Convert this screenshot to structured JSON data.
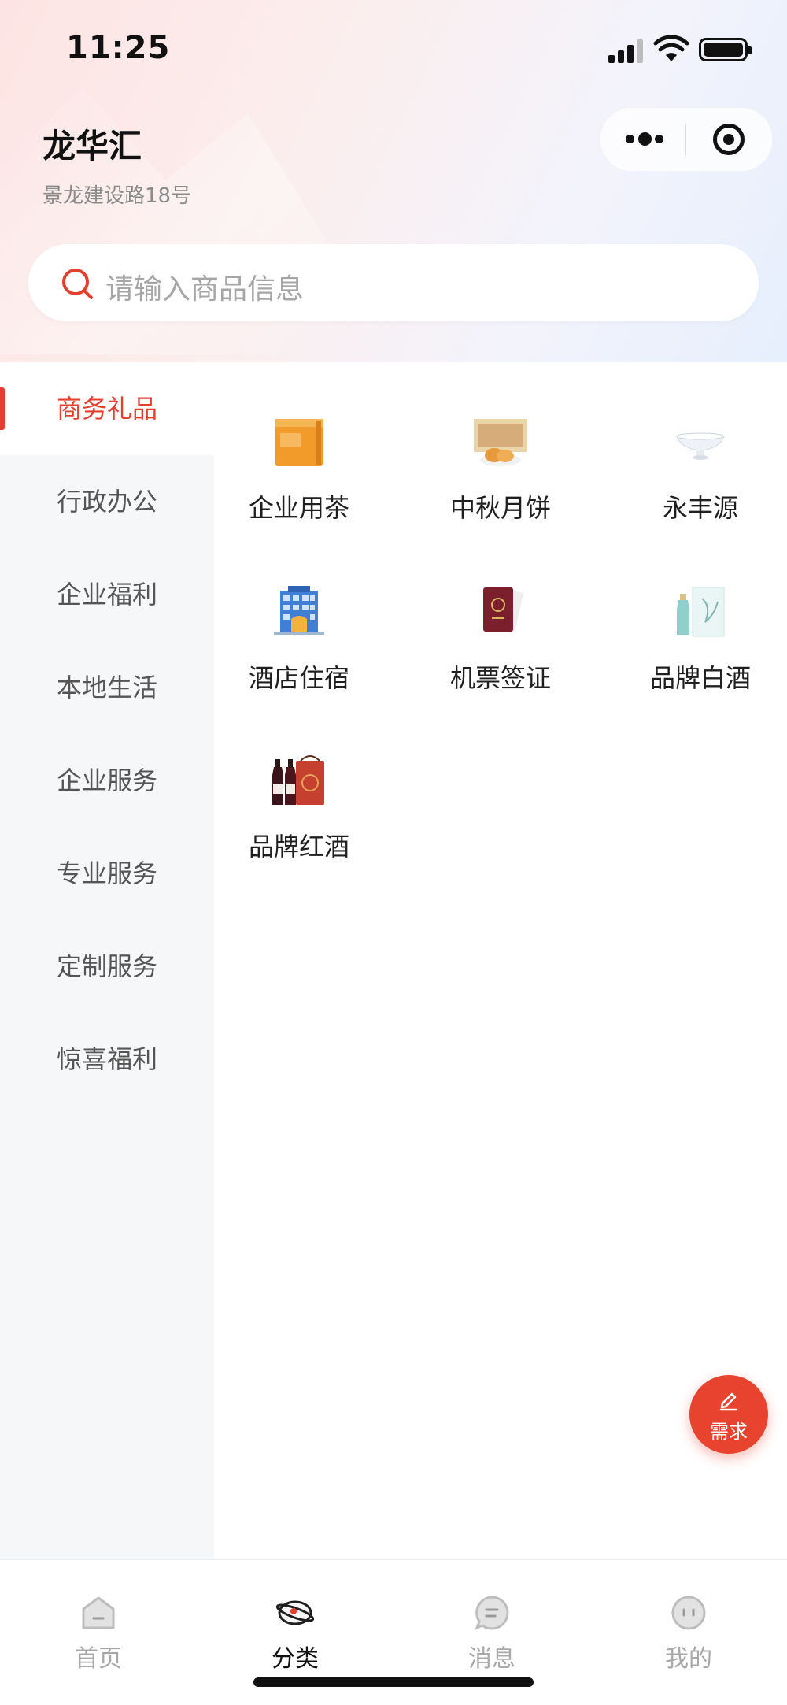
{
  "status_bar": {
    "time": "11:25"
  },
  "header": {
    "title": "龙华汇",
    "subtitle": "景龙建设路18号"
  },
  "search": {
    "placeholder": "请输入商品信息"
  },
  "sidebar": {
    "items": [
      {
        "label": "商务礼品",
        "active": true
      },
      {
        "label": "行政办公",
        "active": false
      },
      {
        "label": "企业福利",
        "active": false
      },
      {
        "label": "本地生活",
        "active": false
      },
      {
        "label": "企业服务",
        "active": false
      },
      {
        "label": "专业服务",
        "active": false
      },
      {
        "label": "定制服务",
        "active": false
      },
      {
        "label": "惊喜福利",
        "active": false
      }
    ]
  },
  "categories": [
    {
      "label": "企业用茶",
      "icon": "tea-box-icon"
    },
    {
      "label": "中秋月饼",
      "icon": "mooncake-icon"
    },
    {
      "label": "永丰源",
      "icon": "porcelain-bowl-icon"
    },
    {
      "label": "酒店住宿",
      "icon": "hotel-icon"
    },
    {
      "label": "机票签证",
      "icon": "passport-icon"
    },
    {
      "label": "品牌白酒",
      "icon": "baijiu-icon"
    },
    {
      "label": "品牌红酒",
      "icon": "red-wine-icon"
    }
  ],
  "fab": {
    "label": "需求",
    "icon": "pencil-icon"
  },
  "tabbar": {
    "tabs": [
      {
        "label": "首页",
        "icon": "home-icon",
        "active": false
      },
      {
        "label": "分类",
        "icon": "category-icon",
        "active": true
      },
      {
        "label": "消息",
        "icon": "message-icon",
        "active": false
      },
      {
        "label": "我的",
        "icon": "profile-icon",
        "active": false
      }
    ]
  },
  "colors": {
    "accent": "#e5402f",
    "sidebar_bg": "#f6f7f9",
    "inactive_text": "#a8a8a8"
  }
}
